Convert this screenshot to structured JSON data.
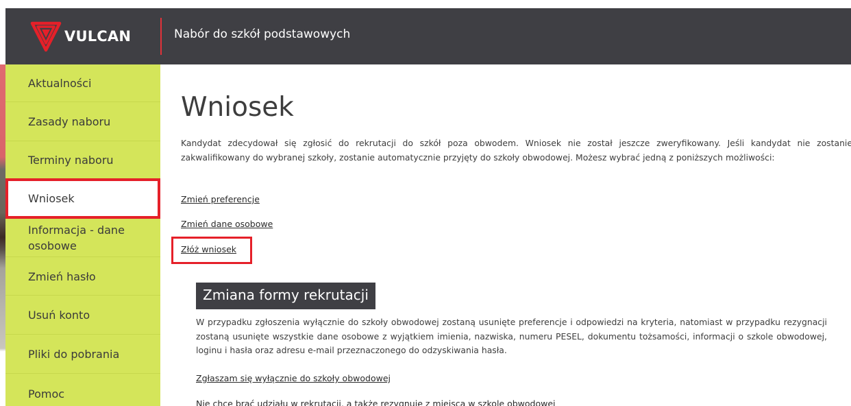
{
  "header": {
    "logo_text": "VULCAN",
    "title": "Nabór do szkół podstawowych"
  },
  "sidebar": {
    "items": [
      {
        "label": "Aktualności"
      },
      {
        "label": "Zasady naboru"
      },
      {
        "label": "Terminy naboru"
      },
      {
        "label": "Wniosek",
        "active": true
      },
      {
        "label": "Informacja - dane osobowe"
      },
      {
        "label": "Zmień hasło"
      },
      {
        "label": "Usuń konto"
      },
      {
        "label": "Pliki do pobrania"
      },
      {
        "label": "Pomoc"
      }
    ]
  },
  "main": {
    "title": "Wniosek",
    "intro": "Kandydat zdecydował się zgłosić do rekrutacji do szkół poza obwodem. Wniosek nie został jeszcze zweryfikowany. Jeśli kandydat nie zostanie zakwalifikowany do wybranej szkoły, zostanie automatycznie przyjęty do szkoły obwodowej. Możesz wybrać jedną z poniższych możliwości:",
    "links": {
      "change_preferences": "Zmień preferencje",
      "change_personal_data": "Zmień dane osobowe",
      "submit_application": "Złóż wniosek"
    },
    "section": {
      "heading": "Zmiana formy rekrutacji",
      "body": "W przypadku zgłoszenia wyłącznie do szkoły obwodowej zostaną usunięte preferencje i odpowiedzi na kryteria, natomiast w przypadku rezygnacji zostaną usunięte wszystkie dane osobowe z wyjątkiem imienia, nazwiska, numeru PESEL, dokumentu tożsamości, informacji o szkole obwodowej, loginu i hasła oraz adresu e-mail przeznaczonego do odzyskiwania hasła.",
      "link_district_only": "Zgłaszam się wyłącznie do szkoły obwodowej",
      "link_resign": "Nie chcę brać udziału w rekrutacji, a także rezygnuję z miejsca w szkole obwodowej"
    }
  },
  "colors": {
    "header_bg": "#3f3f44",
    "sidebar_bg": "#d4e55a",
    "accent_red": "#e52029"
  }
}
